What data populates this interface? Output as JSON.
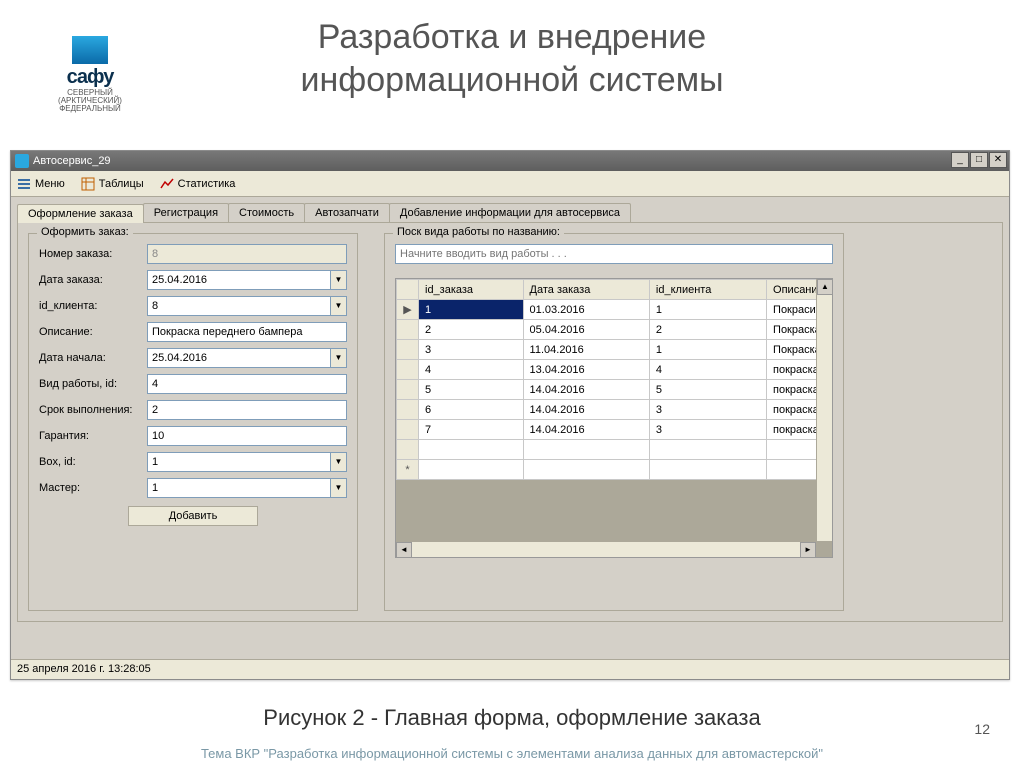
{
  "slide": {
    "title_line1": "Разработка и внедрение",
    "title_line2": "информационной системы",
    "caption": "Рисунок 2 - Главная форма, оформление заказа",
    "footer": "Тема ВКР \"Разработка информационной системы с элементами анализа данных для автомастерской\"",
    "page": "12"
  },
  "logo": {
    "main": "сафу",
    "sub1": "СЕВЕРНЫЙ",
    "sub2": "(АРКТИЧЕСКИЙ)",
    "sub3": "ФЕДЕРАЛЬНЫЙ"
  },
  "app": {
    "title": "Автосервис_29",
    "toolbar": {
      "menu": "Меню",
      "tables": "Таблицы",
      "stats": "Статистика"
    },
    "tabs": [
      "Оформление заказа",
      "Регистрация",
      "Стоимость",
      "Автозапчати",
      "Добавление информации для автосервиса"
    ],
    "form": {
      "group_title": "Оформить заказ:",
      "fields": {
        "order_no": {
          "label": "Номер заказа:",
          "value": "8"
        },
        "order_date": {
          "label": "Дата заказа:",
          "value": "25.04.2016"
        },
        "client_id": {
          "label": "id_клиента:",
          "value": "8"
        },
        "descr": {
          "label": "Описание:",
          "value": "Покраска переднего бампера"
        },
        "start_date": {
          "label": "Дата начала:",
          "value": "25.04.2016"
        },
        "work_id": {
          "label": "Вид работы, id:",
          "value": "4"
        },
        "duration": {
          "label": "Срок выполнения:",
          "value": "2"
        },
        "warranty": {
          "label": "Гарантия:",
          "value": "10"
        },
        "box_id": {
          "label": "Box, id:",
          "value": "1"
        },
        "master": {
          "label": "Мастер:",
          "value": "1"
        }
      },
      "add_button": "Добавить"
    },
    "search": {
      "group_title": "Поск вида работы по названию:",
      "placeholder": "Начните вводить вид работы . . ."
    },
    "grid": {
      "columns": [
        "id_заказа",
        "Дата заказа",
        "id_клиента",
        "Описание"
      ],
      "rows": [
        {
          "id": "1",
          "date": "01.03.2016",
          "client": "1",
          "descr": "Покрасит"
        },
        {
          "id": "2",
          "date": "05.04.2016",
          "client": "2",
          "descr": "Покраска"
        },
        {
          "id": "3",
          "date": "11.04.2016",
          "client": "1",
          "descr": "Покраска"
        },
        {
          "id": "4",
          "date": "13.04.2016",
          "client": "4",
          "descr": "покраска"
        },
        {
          "id": "5",
          "date": "14.04.2016",
          "client": "5",
          "descr": "покраска"
        },
        {
          "id": "6",
          "date": "14.04.2016",
          "client": "3",
          "descr": "покраска"
        },
        {
          "id": "7",
          "date": "14.04.2016",
          "client": "3",
          "descr": "покраска"
        }
      ]
    },
    "status": "25 апреля 2016 г.   13:28:05"
  }
}
